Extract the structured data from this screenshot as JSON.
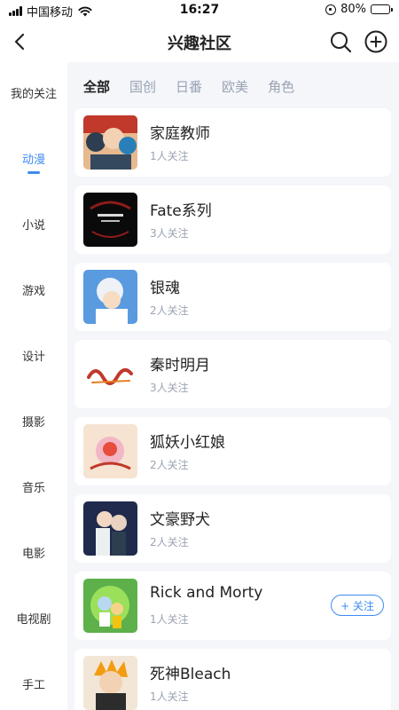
{
  "status_bar": {
    "carrier": "中国移动",
    "time": "16:27",
    "battery": "80%",
    "battery_level": 0.8
  },
  "header": {
    "title": "兴趣社区",
    "back_icon": "chevron-left-icon",
    "search_icon": "search-icon",
    "add_icon": "plus-circle-icon"
  },
  "sidebar": {
    "items": [
      {
        "label": "我的关注"
      },
      {
        "label": "动漫",
        "active": true
      },
      {
        "label": "小说"
      },
      {
        "label": "游戏"
      },
      {
        "label": "设计"
      },
      {
        "label": "摄影"
      },
      {
        "label": "音乐"
      },
      {
        "label": "电影"
      },
      {
        "label": "电视剧"
      },
      {
        "label": "手工"
      }
    ]
  },
  "tabs": [
    "全部",
    "国创",
    "日番",
    "欧美",
    "角色"
  ],
  "cards": [
    {
      "name": "家庭教师",
      "followers": "1人关注"
    },
    {
      "name": "Fate系列",
      "followers": "3人关注"
    },
    {
      "name": "银魂",
      "followers": "2人关注"
    },
    {
      "name": "秦时明月",
      "followers": "3人关注"
    },
    {
      "name": "狐妖小红娘",
      "followers": "2人关注"
    },
    {
      "name": "文豪野犬",
      "followers": "2人关注"
    },
    {
      "name": "Rick and Morty",
      "followers": "1人关注",
      "follow_button": "+ 关注"
    },
    {
      "name": "死神Bleach",
      "followers": "1人关注"
    }
  ],
  "colors": {
    "accent": "#3d8bf2",
    "muted_text": "#9aa3b2",
    "panel_bg": "#f4f6fa"
  }
}
